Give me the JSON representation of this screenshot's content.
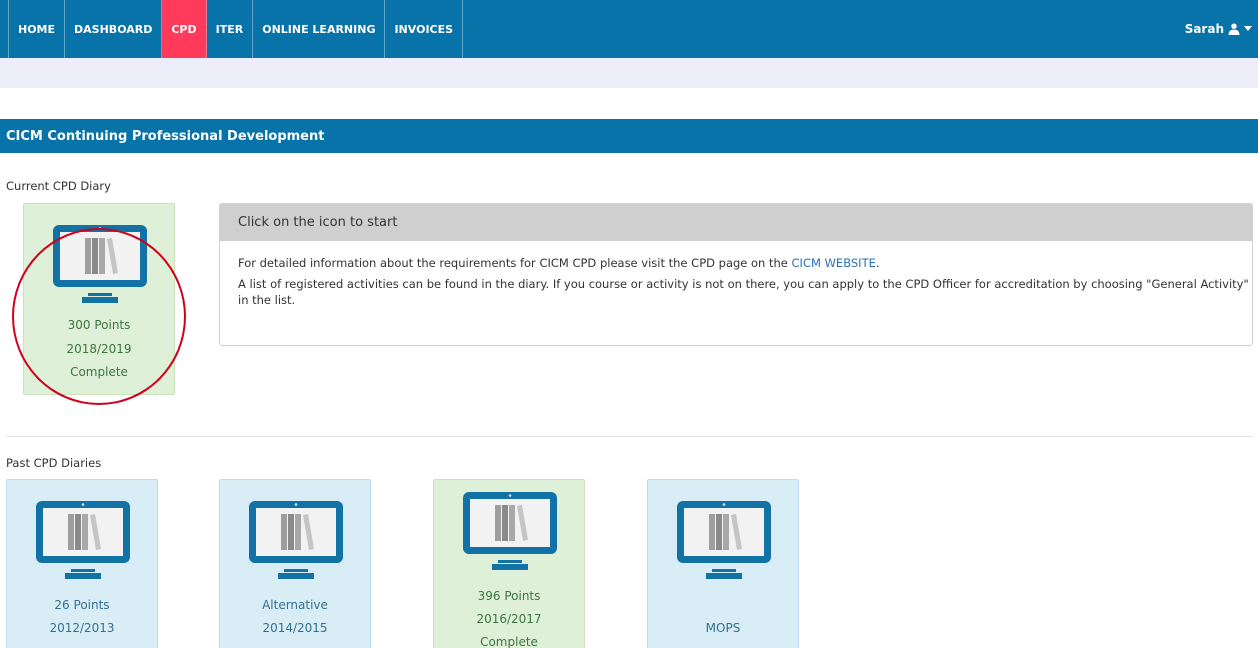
{
  "nav": {
    "items": [
      {
        "label": "HOME",
        "active": false
      },
      {
        "label": "DASHBOARD",
        "active": false
      },
      {
        "label": "CPD",
        "active": true
      },
      {
        "label": "ITER",
        "active": false
      },
      {
        "label": "ONLINE LEARNING",
        "active": false
      },
      {
        "label": "INVOICES",
        "active": false
      }
    ],
    "user": "Sarah",
    "user_icon": "user-icon",
    "caret_icon": "caret-down-icon"
  },
  "section_title": "CICM Continuing Professional Development",
  "current": {
    "label": "Current CPD Diary",
    "card": {
      "line1": "300 Points",
      "line2": "2018/2019",
      "line3": "Complete",
      "status": "green"
    }
  },
  "info": {
    "heading": "Click on the icon to start",
    "p1_before": "For detailed information about the requirements for CICM CPD please visit the CPD page on the ",
    "p1_link": "CICM WEBSITE",
    "p1_after": ".",
    "p2": "A list of registered activities can be found in the diary. If you course or activity is not on there, you can apply to the CPD Officer for accreditation by choosing \"General Activity\" in the list."
  },
  "past": {
    "label": "Past CPD Diaries",
    "cards": [
      {
        "line1": "26 Points",
        "line2": "2012/2013",
        "line3": "",
        "status": "blue"
      },
      {
        "line1": "Alternative",
        "line2": "2014/2015",
        "line3": "",
        "status": "blue"
      },
      {
        "line1": "396 Points",
        "line2": "2016/2017",
        "line3": "Complete",
        "status": "green"
      },
      {
        "line1": "",
        "line2": "MOPS",
        "line3": "",
        "status": "blue"
      }
    ]
  },
  "colors": {
    "nav_bg": "#0873a8",
    "nav_active": "#ff3a5b",
    "monitor": "#1272a6",
    "highlight_circle": "#d0021b"
  }
}
